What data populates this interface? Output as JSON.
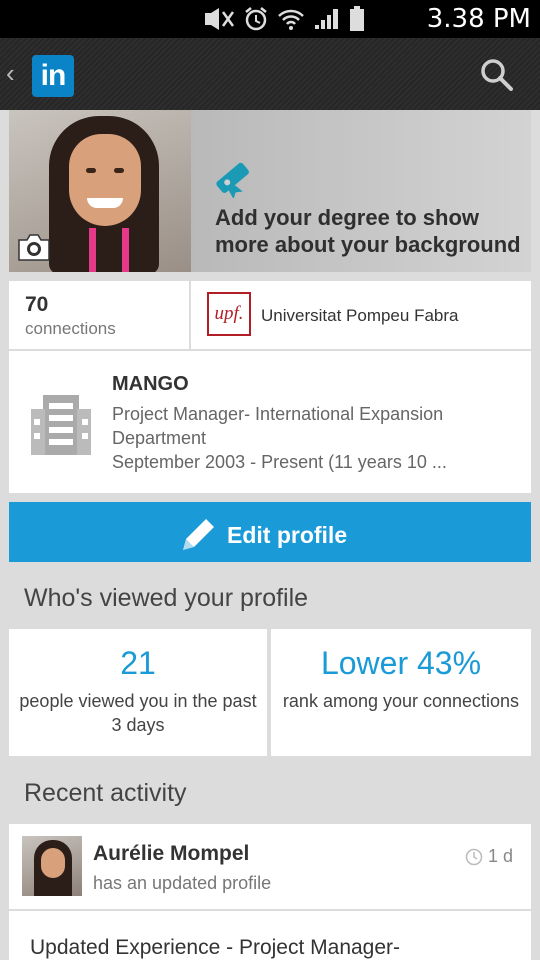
{
  "status_bar": {
    "time": "3.38 PM",
    "icons": [
      "mute-icon",
      "alarm-icon",
      "wifi-icon",
      "signal-icon",
      "battery-icon"
    ]
  },
  "app_bar": {
    "logo_text": "in",
    "back_icon": "chevron-left-icon",
    "search_icon": "search-icon"
  },
  "header": {
    "degree_prompt": "Add your degree to show more about your background"
  },
  "connections": {
    "count": "70",
    "label": "connections"
  },
  "education": {
    "logo_text": "upf.",
    "school": "Universitat Pompeu Fabra"
  },
  "position": {
    "company": "MANGO",
    "title": "Project Manager- International Expansion Department",
    "dates": "September 2003 - Present (11 years 10 ..."
  },
  "edit_profile": {
    "label": "Edit profile"
  },
  "who_viewed": {
    "heading": "Who's viewed your profile",
    "views_value": "21",
    "views_desc": "people viewed you in the past 3 days",
    "rank_value": "Lower 43%",
    "rank_desc": "rank among your connections"
  },
  "recent_activity": {
    "heading": "Recent activity",
    "name": "Aurélie Mompel",
    "subtitle": "has an updated profile",
    "time": "1 d",
    "update_text": "Updated Experience - Project Manager-"
  },
  "colors": {
    "accent": "#1a9ad6",
    "linkedin_blue": "#0a84c6",
    "upf_red": "#b21e25",
    "degree_icon": "#1a9ab5"
  }
}
